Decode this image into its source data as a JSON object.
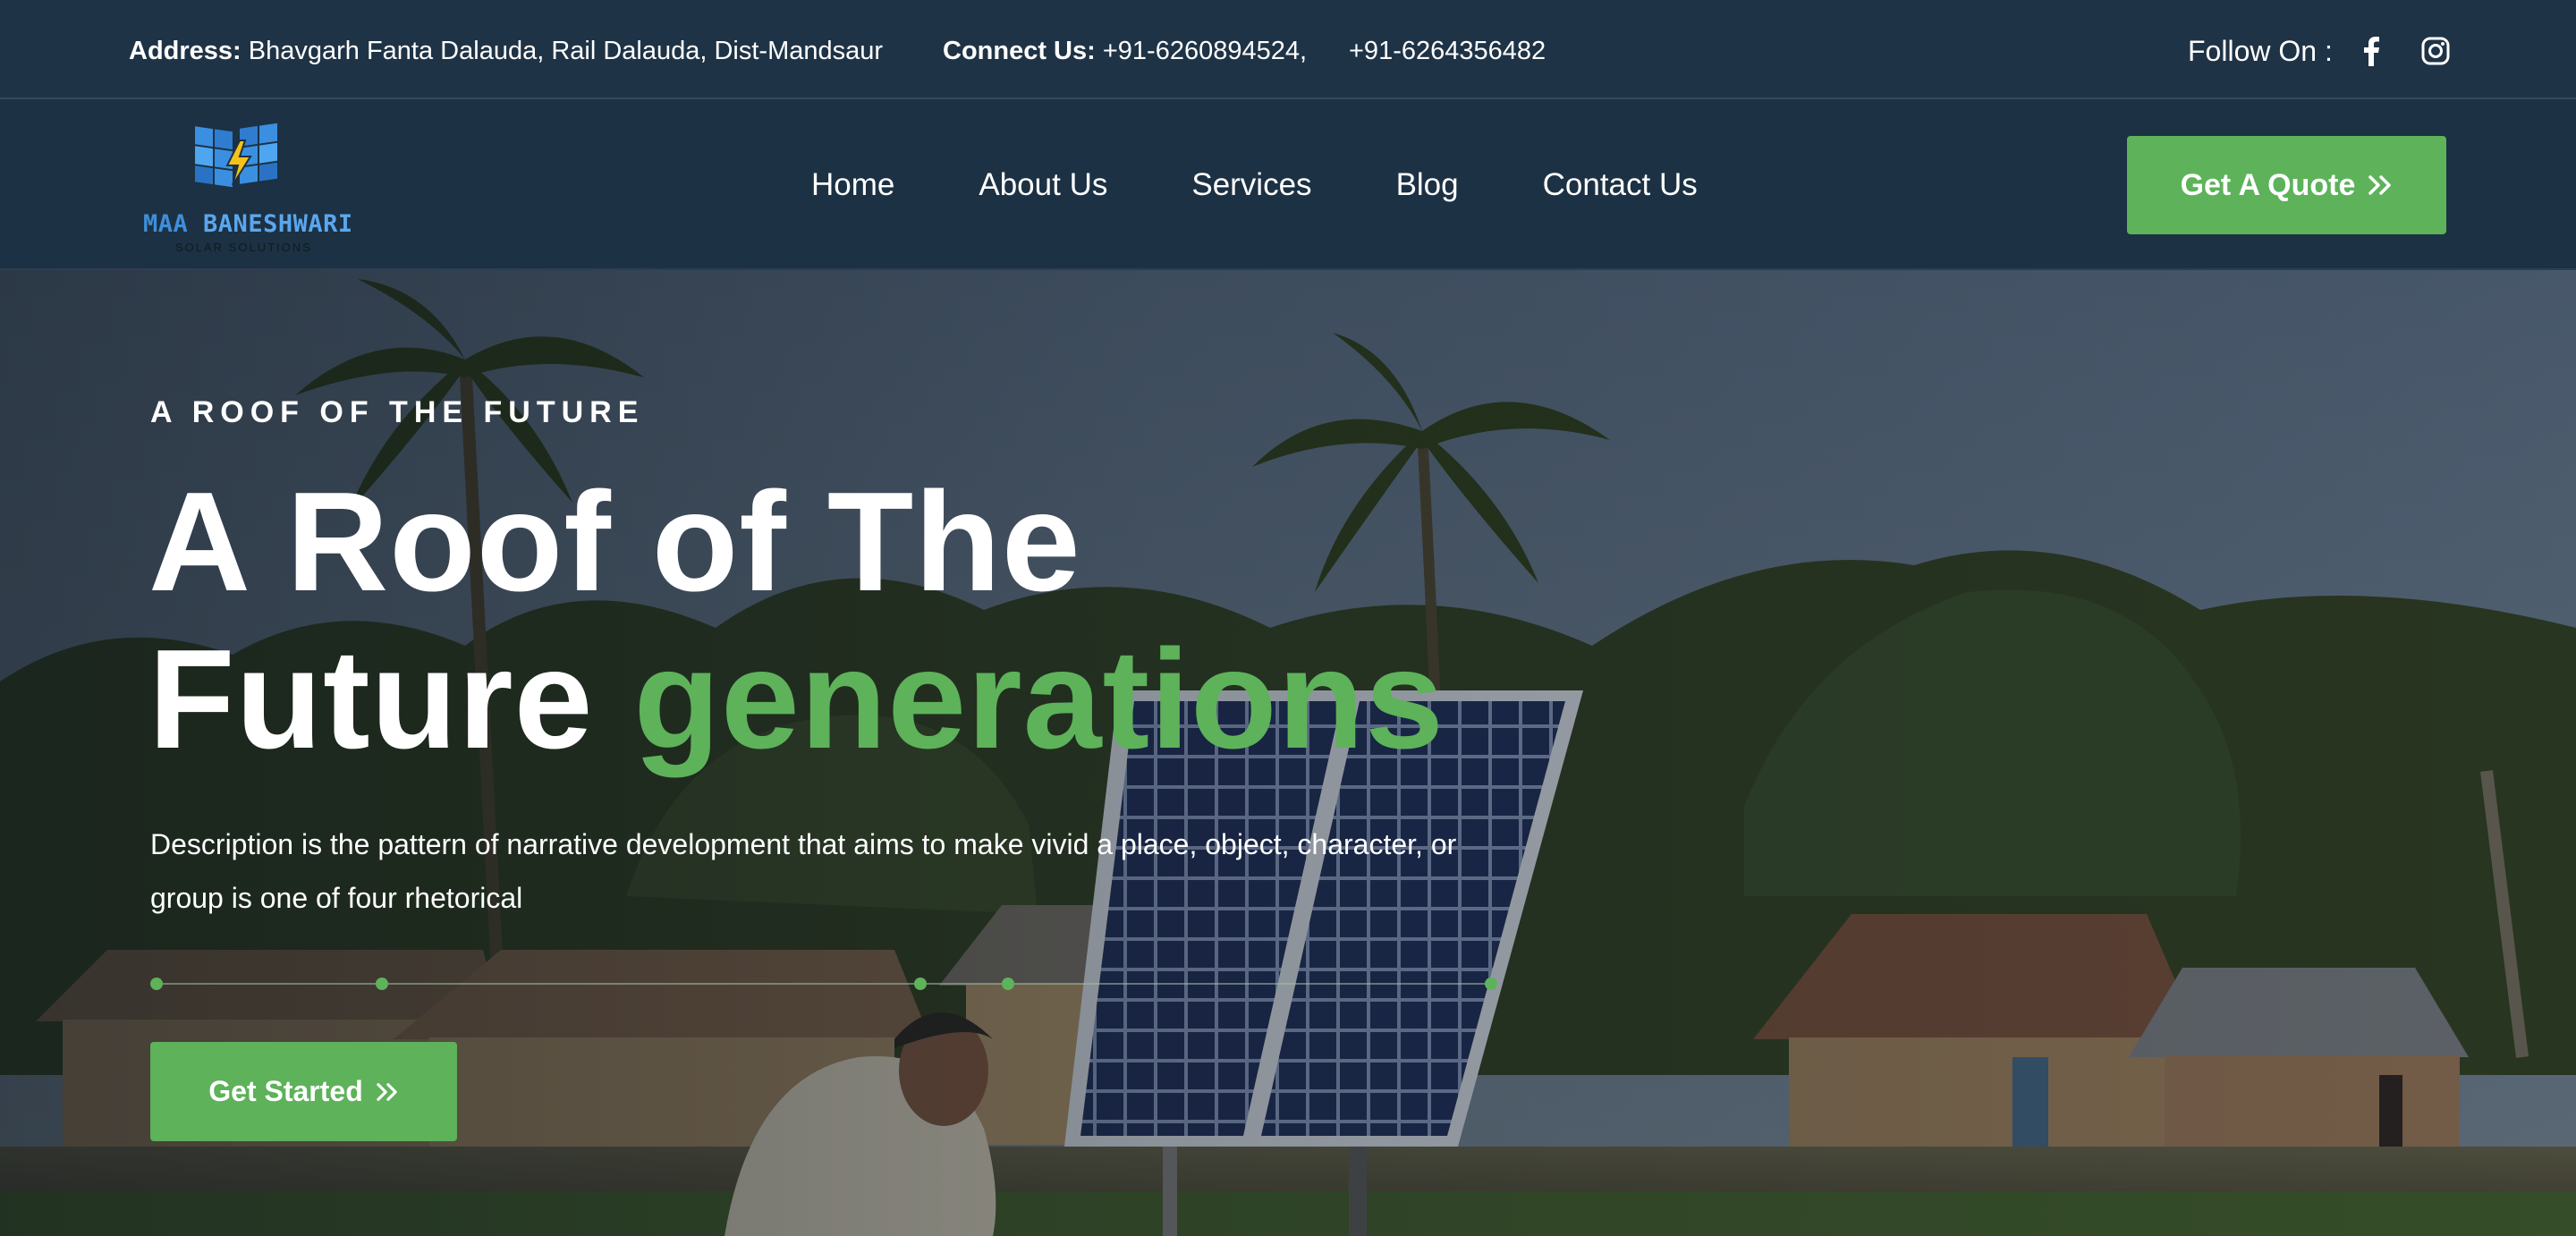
{
  "topbar": {
    "address_label": "Address:",
    "address_value": "Bhavgarh Fanta Dalauda, Rail Dalauda, Dist-Mandsaur",
    "connect_label": "Connect Us:",
    "phone_1": "+91-6260894524,",
    "phone_2": "+91-6264356482",
    "follow_label": "Follow On :",
    "social_icons": [
      "facebook-icon",
      "instagram-icon"
    ]
  },
  "logo": {
    "name_part1": "MAA",
    "name_part2": "BANESHWARI",
    "tagline": "SOLAR SOLUTIONS"
  },
  "nav": {
    "items": [
      {
        "label": "Home"
      },
      {
        "label": "About Us"
      },
      {
        "label": "Services"
      },
      {
        "label": "Blog"
      },
      {
        "label": "Contact Us"
      }
    ],
    "cta_label": "Get A Quote",
    "cta_icon": "double-chevron-right-icon"
  },
  "hero": {
    "eyebrow": "A ROOF OF THE FUTURE",
    "title_line1": "A Roof of The",
    "title_line2_plain": "Future",
    "title_line2_accent": "generations",
    "description": "Description is the pattern of narrative development that aims to make vivid a place, object, character, or group is one of four rhetorical",
    "cta_label": "Get Started",
    "cta_icon": "double-chevron-right-icon"
  },
  "colors": {
    "brand_green": "#5db25a",
    "header_bg": "#1c3143",
    "topbar_bg": "#1f3346",
    "logo_blue": "#3e8fd9"
  }
}
